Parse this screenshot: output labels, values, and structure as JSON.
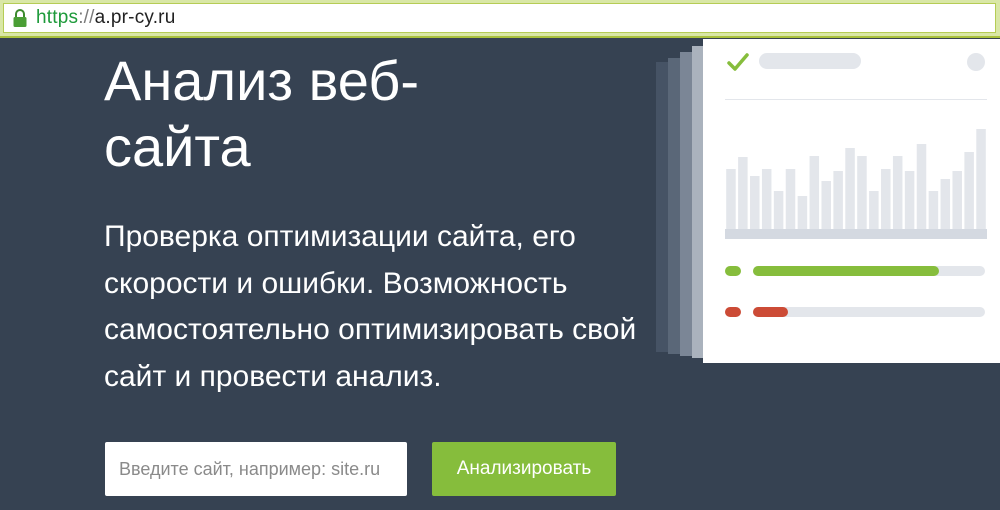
{
  "browser": {
    "url_scheme": "https",
    "url_separator": "://",
    "url_host": "a.pr-cy.ru",
    "scheme_color": "#1d9a3a",
    "lock_icon": "lock-icon"
  },
  "hero": {
    "title": "Анализ веб-сайта",
    "description": "Проверка оптимизации сайта, его скорости и ошибки. Возможность самостоятельно оптимизировать свой сайт и провести анализ."
  },
  "search": {
    "placeholder": "Введите сайт, например: site.ru"
  },
  "analyze_button": {
    "label": "Анализировать",
    "color": "#86bd3c"
  },
  "illustration": {
    "check_icon": "check-icon",
    "accent_green": "#86bd3c",
    "accent_red": "#cc4b36",
    "neutral": "#e3e6eb",
    "bar_values": [
      60,
      72,
      53,
      60,
      38,
      60,
      33,
      73,
      48,
      58,
      81,
      73,
      38,
      60,
      73,
      58,
      85,
      38,
      50,
      58,
      77,
      100
    ],
    "green_progress": 0.8,
    "red_progress": 0.15
  },
  "colors": {
    "background": "#364252",
    "text": "#ffffff"
  }
}
